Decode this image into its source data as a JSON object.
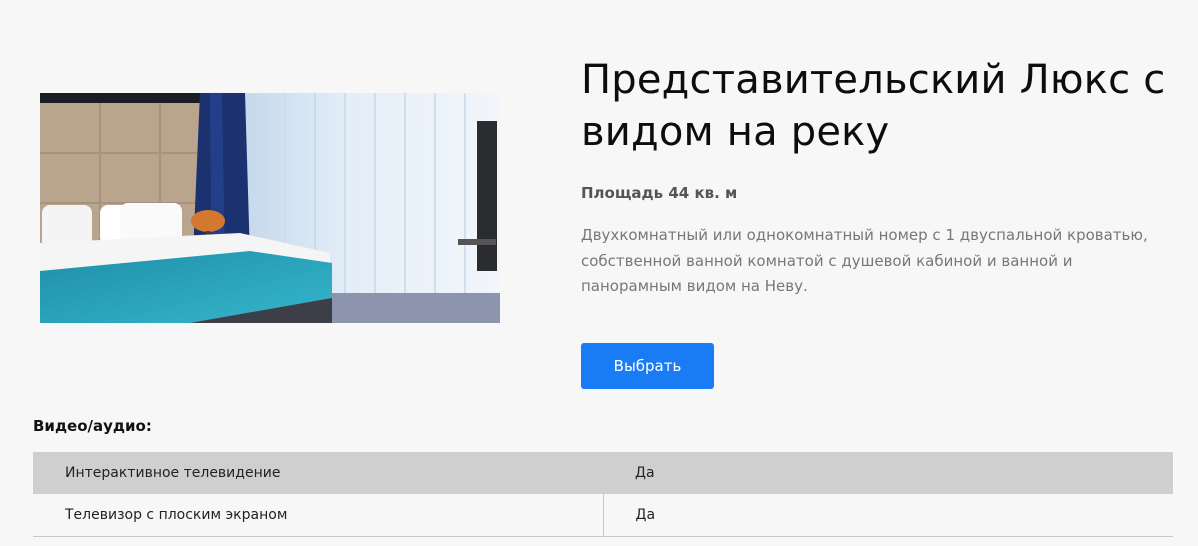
{
  "room": {
    "title": "Представительский Люкс с видом на реку",
    "area": "Площадь 44 кв. м",
    "description": "Двухкомнатный или однокомнатный номер с 1 двуспальной кроватью, собственной ванной комнатой с душевой кабиной и ванной и панорамным видом на Неву.",
    "select_label": "Выбрать"
  },
  "amenities": {
    "heading": "Видео/аудио:",
    "rows": [
      {
        "name": "Интерактивное телевидение",
        "value": "Да"
      },
      {
        "name": "Телевизор с плоским экраном",
        "value": "Да"
      }
    ]
  },
  "colors": {
    "accent": "#1a7cf5",
    "page_background": "#f7f7f7",
    "table_stripe": "#cfcfcf"
  }
}
